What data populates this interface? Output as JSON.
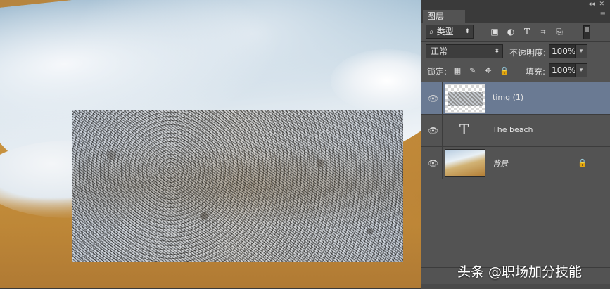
{
  "panel": {
    "tab_label": "图层",
    "filter": {
      "kind_label": "类型",
      "search_glyph": "⌕"
    },
    "blend_mode": "正常",
    "opacity_label": "不透明度:",
    "opacity_value": "100%",
    "lock_label": "锁定:",
    "fill_label": "填充:",
    "fill_value": "100%"
  },
  "layers": [
    {
      "name": "timg (1)",
      "type": "image",
      "visible": true,
      "selected": true
    },
    {
      "name": "The beach",
      "type": "text",
      "visible": true,
      "selected": false
    },
    {
      "name": "背景",
      "type": "background",
      "visible": true,
      "selected": false,
      "locked": true
    }
  ],
  "icons": {
    "eye": "👁",
    "text_layer": "T",
    "lock": "🔒",
    "collapse": "◂◂",
    "close": "✕",
    "panel_menu": "≡",
    "dropdown_arrow": "⬍",
    "stepper_arrow": "▾"
  },
  "watermark": "头条 @职场加分技能",
  "colors": {
    "panel_bg": "#535353",
    "selected_layer": "#6a7a93"
  }
}
